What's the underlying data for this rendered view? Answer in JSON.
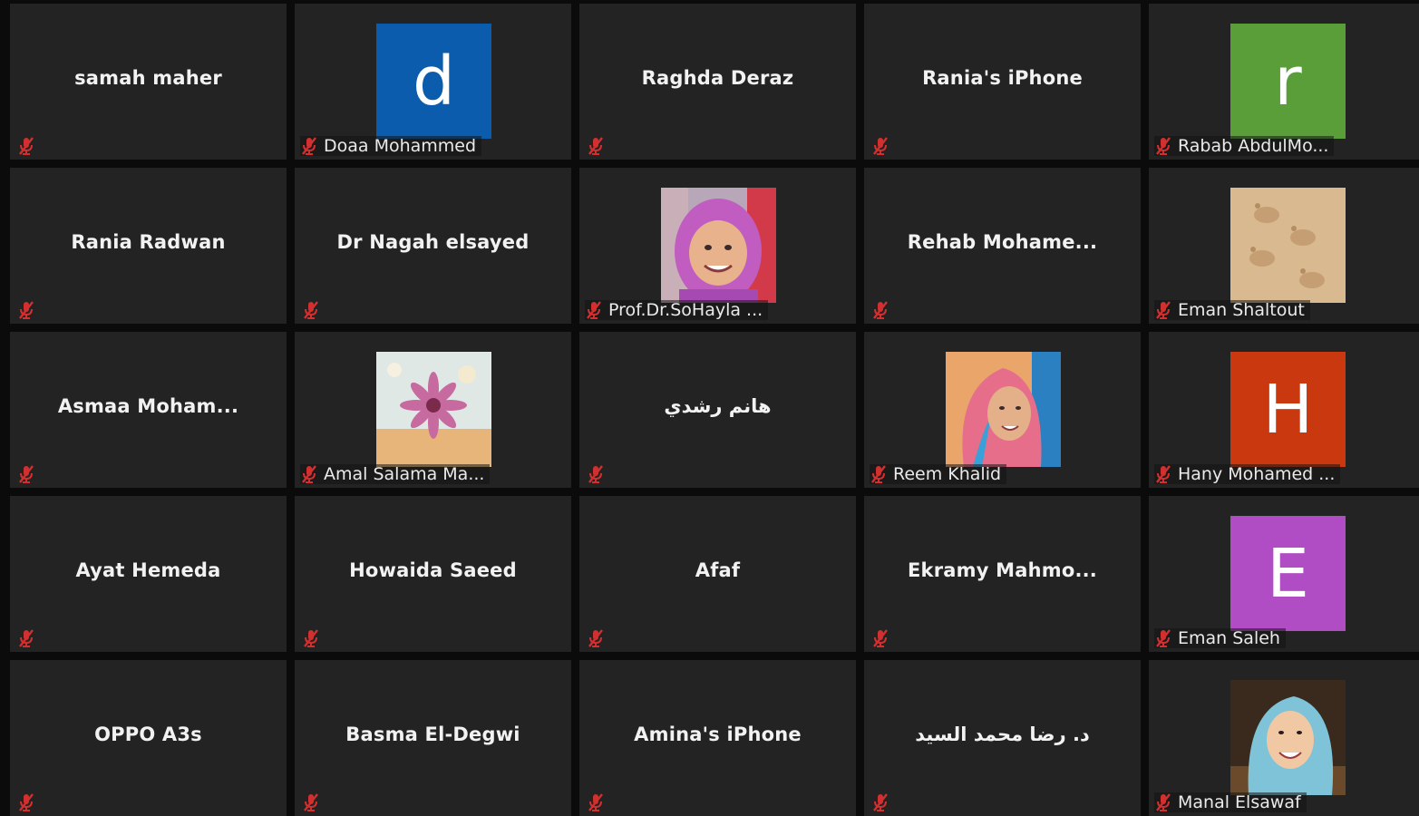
{
  "meeting": {
    "colors": {
      "tile_bg": "#232323",
      "gap": "#0b0b0b",
      "muted_icon": "#d32f2f",
      "name_text": "#f2f2f2"
    },
    "participants": [
      {
        "id": "p1",
        "name": "samah maher",
        "display": "center",
        "muted": true
      },
      {
        "id": "p2",
        "name": "Doaa Mohammed",
        "display": "avatar-letter",
        "letter": "d",
        "avatar_color": "#0b5cad",
        "muted": true
      },
      {
        "id": "p3",
        "name": "Raghda Deraz",
        "display": "center",
        "muted": true
      },
      {
        "id": "p4",
        "name": "Rania's iPhone",
        "display": "center",
        "muted": true
      },
      {
        "id": "p5",
        "name": "Rabab AbdulMo...",
        "display": "avatar-letter",
        "letter": "r",
        "avatar_color": "#5a9e3a",
        "muted": true
      },
      {
        "id": "p6",
        "name": "Rania Radwan",
        "display": "center",
        "muted": true
      },
      {
        "id": "p7",
        "name": "Dr Nagah elsayed",
        "display": "center",
        "muted": true
      },
      {
        "id": "p8",
        "name": "Prof.Dr.SoHayla ...",
        "display": "avatar-photo",
        "photo": "woman-purple-hijab",
        "muted": true
      },
      {
        "id": "p9",
        "name": "Rehab  Mohame...",
        "display": "center",
        "muted": true
      },
      {
        "id": "p10",
        "name": "Eman Shaltout",
        "display": "avatar-photo",
        "photo": "footprints-in-sand",
        "muted": true
      },
      {
        "id": "p11",
        "name": "Asmaa  Moham...",
        "display": "center",
        "muted": true
      },
      {
        "id": "p12",
        "name": "Amal Salama Ma...",
        "display": "avatar-photo",
        "photo": "pink-flower",
        "muted": true
      },
      {
        "id": "p13",
        "name": "هانم رشدي",
        "display": "center",
        "muted": true
      },
      {
        "id": "p14",
        "name": "Reem Khalid",
        "display": "avatar-photo",
        "photo": "woman-pink-scarf",
        "muted": true
      },
      {
        "id": "p15",
        "name": "Hany Mohamed ...",
        "display": "avatar-letter",
        "letter": "H",
        "avatar_color": "#c9380f",
        "muted": true
      },
      {
        "id": "p16",
        "name": "Ayat Hemeda",
        "display": "center",
        "muted": true
      },
      {
        "id": "p17",
        "name": "Howaida Saeed",
        "display": "center",
        "muted": true
      },
      {
        "id": "p18",
        "name": "Afaf",
        "display": "center",
        "muted": true
      },
      {
        "id": "p19",
        "name": "Ekramy  Mahmo...",
        "display": "center",
        "muted": true
      },
      {
        "id": "p20",
        "name": "Eman Saleh",
        "display": "avatar-letter",
        "letter": "E",
        "avatar_color": "#b04cc4",
        "muted": true
      },
      {
        "id": "p21",
        "name": "OPPO A3s",
        "display": "center",
        "muted": true
      },
      {
        "id": "p22",
        "name": "Basma El-Degwi",
        "display": "center",
        "muted": true
      },
      {
        "id": "p23",
        "name": "Amina's iPhone",
        "display": "center",
        "muted": true
      },
      {
        "id": "p24",
        "name": "د. رضا محمد السيد",
        "display": "center",
        "muted": true
      },
      {
        "id": "p25",
        "name": "Manal Elsawaf",
        "display": "avatar-photo",
        "photo": "woman-white-hijab",
        "muted": true
      }
    ]
  }
}
